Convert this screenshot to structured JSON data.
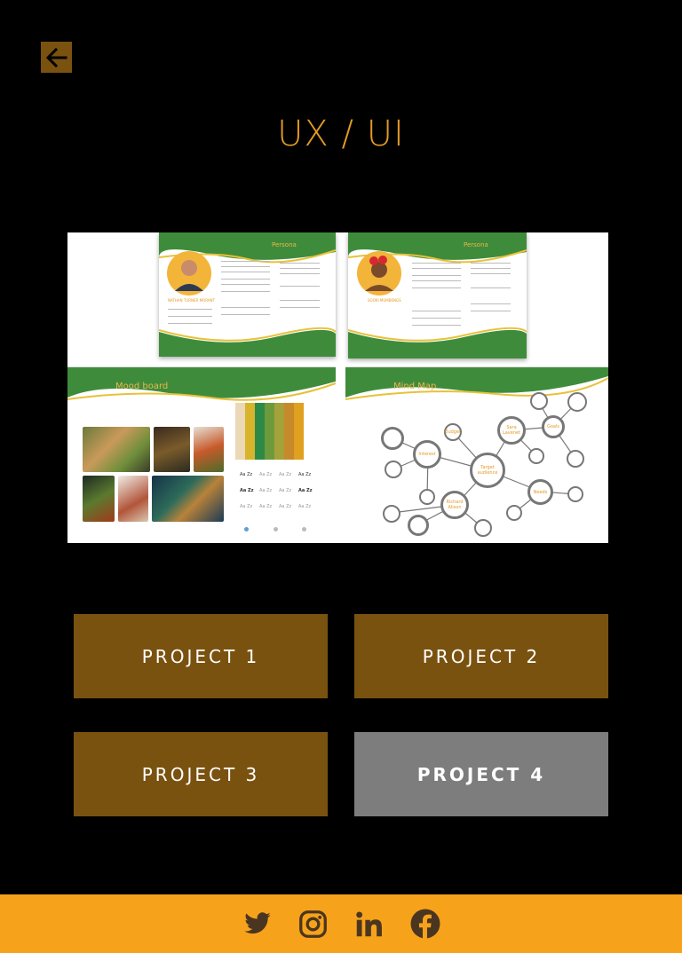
{
  "header": {
    "title": "UX / UI",
    "back_icon": "arrow-left-icon"
  },
  "slides": {
    "persona": "Persona",
    "mood_board": "Mood board",
    "mind_map": "Mind Map",
    "persona_names": [
      "NATHAN TURNER MORANT",
      "SOOKI MUMBENGS"
    ],
    "type_sample": "Aa Zz",
    "mind_map_nodes": [
      "Target audience",
      "Interest",
      "Richard Alison",
      "Sara Lavenet",
      "Needs",
      "Budget",
      "Goals"
    ]
  },
  "projects": [
    {
      "label": "PROJECT 1",
      "active": false
    },
    {
      "label": "PROJECT 2",
      "active": false
    },
    {
      "label": "PROJECT 3",
      "active": false
    },
    {
      "label": "PROJECT 4",
      "active": true
    }
  ],
  "footer": {
    "icons": [
      "twitter-icon",
      "instagram-icon",
      "linkedin-icon",
      "facebook-icon"
    ]
  },
  "colors": {
    "accent": "#e39a25",
    "button": "#7a5210",
    "active_button": "#7d7d7d",
    "footer": "#f7a21b",
    "slide_green": "#3e8c3b"
  }
}
